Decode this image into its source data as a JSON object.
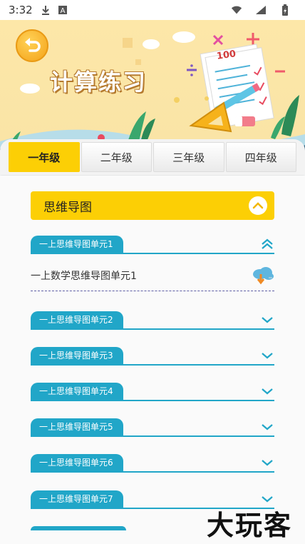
{
  "status_bar": {
    "time": "3:32",
    "icons": [
      "download-icon",
      "font-icon",
      "wifi-icon",
      "signal-icon",
      "battery-icon"
    ]
  },
  "header": {
    "title": "计算练习",
    "decor_text": "100"
  },
  "tabs": [
    {
      "label": "一年级",
      "active": true
    },
    {
      "label": "二年级",
      "active": false
    },
    {
      "label": "三年级",
      "active": false
    },
    {
      "label": "四年级",
      "active": false
    }
  ],
  "section": {
    "title": "思维导图"
  },
  "units": [
    {
      "label": "一上思维导图单元1",
      "expanded": true
    },
    {
      "label": "一上思维导图单元2",
      "expanded": false
    },
    {
      "label": "一上思维导图单元3",
      "expanded": false
    },
    {
      "label": "一上思维导图单元4",
      "expanded": false
    },
    {
      "label": "一上思维导图单元5",
      "expanded": false
    },
    {
      "label": "一上思维导图单元6",
      "expanded": false
    },
    {
      "label": "一上思维导图单元7",
      "expanded": false
    }
  ],
  "expanded_items": [
    {
      "label": "一上数学思维导图单元1"
    }
  ],
  "watermark": "大玩客",
  "colors": {
    "accent_yellow": "#fccf05",
    "unit_blue": "#21a6c8",
    "banner": "#fde7a8"
  }
}
